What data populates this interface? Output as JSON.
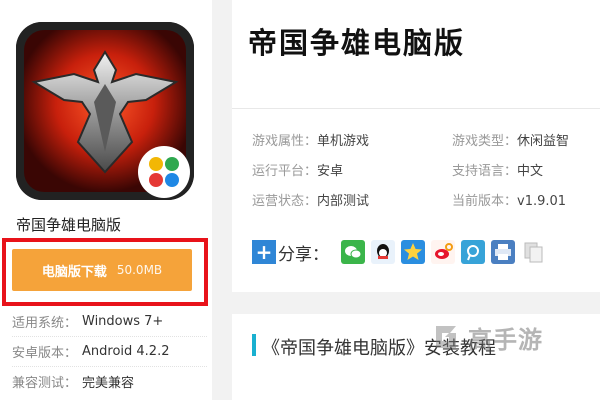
{
  "app": {
    "name": "帝国争雄电脑版"
  },
  "download": {
    "label": "电脑版下载",
    "size": "50.0MB"
  },
  "specs": [
    {
      "k": "适用系统：",
      "v": "Windows 7+"
    },
    {
      "k": "安卓版本：",
      "v": "Android 4.2.2"
    },
    {
      "k": "兼容测试：",
      "v": "完美兼容"
    }
  ],
  "title": "帝国争雄电脑版",
  "attributes": [
    {
      "k": "游戏属性：",
      "v": "单机游戏"
    },
    {
      "k": "游戏类型：",
      "v": "休闲益智"
    },
    {
      "k": "运行平台：",
      "v": "安卓"
    },
    {
      "k": "支持语言：",
      "v": "中文"
    },
    {
      "k": "运营状态：",
      "v": "内部测试"
    },
    {
      "k": "当前版本：",
      "v": "v1.9.01"
    }
  ],
  "share": {
    "plus": "+",
    "label": "分享：",
    "icons": [
      "wechat-icon",
      "qq-icon",
      "qzone-icon",
      "weibo-icon",
      "tencent-weibo-icon",
      "print-icon",
      "copy-icon"
    ]
  },
  "section": {
    "title": "《帝国争雄电脑版》安装教程"
  },
  "watermark": {
    "text": "高手游"
  },
  "colors": {
    "download": "#f5a33a",
    "highlight_frame": "#e8121a",
    "share_blue": "#2f86d6",
    "accent": "#19b0d0"
  }
}
